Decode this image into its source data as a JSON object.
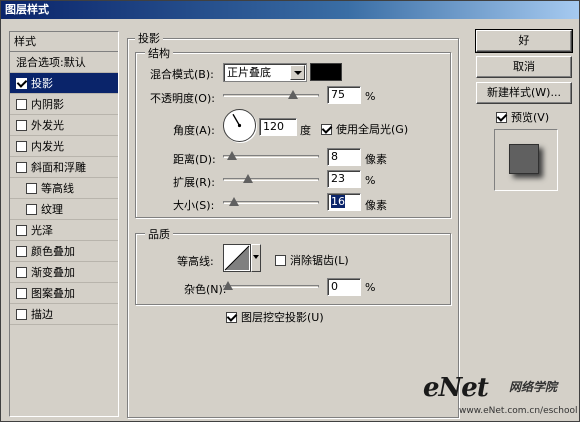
{
  "window": {
    "title": "图层样式"
  },
  "sidebar": {
    "header": "样式",
    "items": [
      {
        "label": "混合选项:默认",
        "checkbox": false,
        "checked": false,
        "selected": false,
        "indent": false
      },
      {
        "label": "投影",
        "checkbox": true,
        "checked": true,
        "selected": true,
        "indent": false
      },
      {
        "label": "内阴影",
        "checkbox": true,
        "checked": false,
        "selected": false,
        "indent": false
      },
      {
        "label": "外发光",
        "checkbox": true,
        "checked": false,
        "selected": false,
        "indent": false
      },
      {
        "label": "内发光",
        "checkbox": true,
        "checked": false,
        "selected": false,
        "indent": false
      },
      {
        "label": "斜面和浮雕",
        "checkbox": true,
        "checked": false,
        "selected": false,
        "indent": false
      },
      {
        "label": "等高线",
        "checkbox": true,
        "checked": false,
        "selected": false,
        "indent": true
      },
      {
        "label": "纹理",
        "checkbox": true,
        "checked": false,
        "selected": false,
        "indent": true
      },
      {
        "label": "光泽",
        "checkbox": true,
        "checked": false,
        "selected": false,
        "indent": false
      },
      {
        "label": "颜色叠加",
        "checkbox": true,
        "checked": false,
        "selected": false,
        "indent": false
      },
      {
        "label": "渐变叠加",
        "checkbox": true,
        "checked": false,
        "selected": false,
        "indent": false
      },
      {
        "label": "图案叠加",
        "checkbox": true,
        "checked": false,
        "selected": false,
        "indent": false
      },
      {
        "label": "描边",
        "checkbox": true,
        "checked": false,
        "selected": false,
        "indent": false
      }
    ]
  },
  "panel": {
    "title": "投影",
    "structure": {
      "title": "结构",
      "blend_mode": {
        "label": "混合模式(B):",
        "value": "正片叠底",
        "color": "#000000"
      },
      "opacity": {
        "label": "不透明度(O):",
        "value": "75",
        "unit": "%",
        "level": 0.75
      },
      "angle": {
        "label": "角度(A):",
        "value": "120",
        "unit": "度",
        "global_light_label": "使用全局光(G)",
        "global_light_checked": true,
        "degrees": 120
      },
      "distance": {
        "label": "距离(D):",
        "value": "8",
        "unit": "像素",
        "level": 0.05
      },
      "spread": {
        "label": "扩展(R):",
        "value": "23",
        "unit": "%",
        "level": 0.23
      },
      "size": {
        "label": "大小(S):",
        "value": "16",
        "unit": "像素",
        "level": 0.07
      }
    },
    "quality": {
      "title": "品质",
      "contour": {
        "label": "等高线:",
        "anti_alias_label": "消除锯齿(L)",
        "anti_alias_checked": false
      },
      "noise": {
        "label": "杂色(N):",
        "value": "0",
        "unit": "%",
        "level": 0
      },
      "knockout": {
        "label": "图层挖空投影(U)",
        "checked": true
      }
    }
  },
  "buttons": {
    "ok": "好",
    "cancel": "取消",
    "new_style": "新建样式(W)...",
    "preview_label": "预览(V)",
    "preview_checked": true
  },
  "watermark": {
    "brand": "eNet",
    "cn": "网络学院",
    "url": "www.eNet.com.cn/eschool"
  }
}
